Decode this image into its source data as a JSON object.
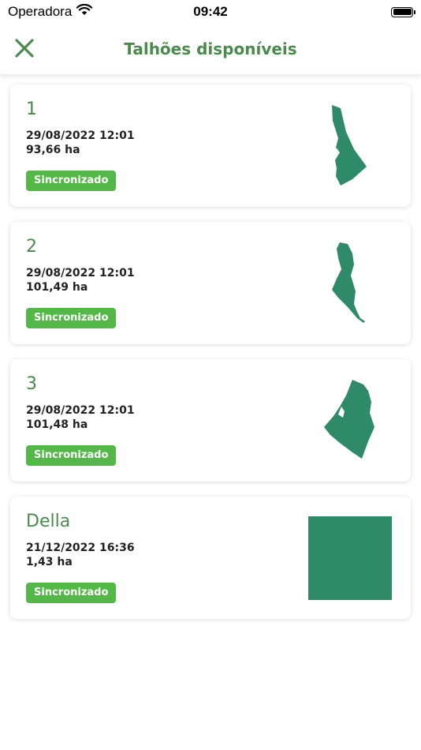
{
  "status_bar": {
    "carrier": "Operadora",
    "time": "09:42"
  },
  "header": {
    "title": "Talhões disponíveis"
  },
  "fields": [
    {
      "name": "1",
      "date": "29/08/2022 12:01",
      "area": "93,66 ha",
      "status": "Sincronizado"
    },
    {
      "name": "2",
      "date": "29/08/2022 12:01",
      "area": "101,49 ha",
      "status": "Sincronizado"
    },
    {
      "name": "3",
      "date": "29/08/2022 12:01",
      "area": "101,48 ha",
      "status": "Sincronizado"
    },
    {
      "name": "Della",
      "date": "21/12/2022 16:36",
      "area": "1,43 ha",
      "status": "Sincronizado"
    }
  ],
  "colors": {
    "brand_green": "#4b8a4d",
    "badge_green": "#54b848",
    "shape_green": "#2e8a68"
  }
}
